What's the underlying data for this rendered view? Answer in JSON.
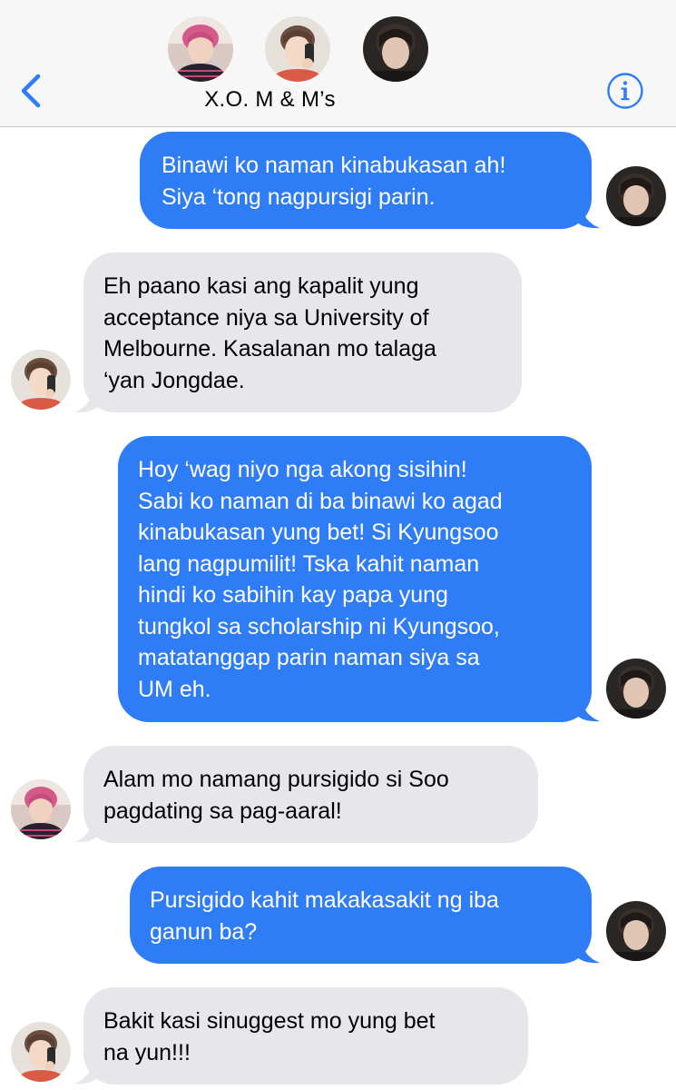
{
  "header": {
    "group_name": "X.O. M & M’s",
    "back_icon": "chevron-left-icon",
    "info_icon": "info-circle-icon",
    "accent_color": "#2e7cf6"
  },
  "messages": [
    {
      "direction": "outgoing",
      "lines": [
        "Binawi ko naman kinabukasan ah!",
        "Siya ‘tong nagpursigi parin."
      ]
    },
    {
      "direction": "incoming",
      "lines": [
        "Eh paano kasi ang kapalit yung",
        "acceptance niya sa University of",
        "Melbourne. Kasalanan mo talaga",
        "‘yan Jongdae."
      ]
    },
    {
      "direction": "outgoing",
      "lines": [
        "Hoy ‘wag niyo nga akong sisihin!",
        "Sabi ko naman di ba binawi ko agad",
        "kinabukasan yung bet! Si Kyungsoo",
        "lang nagpumilit! Tska kahit naman",
        "hindi ko sabihin kay papa yung",
        "tungkol sa scholarship ni Kyungsoo,",
        "matatanggap parin naman siya sa",
        "UM eh."
      ]
    },
    {
      "direction": "incoming",
      "lines": [
        "Alam mo namang pursigido si Soo",
        "pagdating sa pag-aaral!"
      ]
    },
    {
      "direction": "outgoing",
      "lines": [
        "Pursigido kahit makakasakit ng iba",
        "ganun ba?"
      ]
    },
    {
      "direction": "incoming",
      "lines": [
        "Bakit kasi sinuggest mo yung bet",
        "na yun!!!"
      ]
    }
  ],
  "colors": {
    "outgoing_bubble": "#2e7cf6",
    "incoming_bubble": "#e6e6eb",
    "header_bg": "#f7f7f7"
  }
}
